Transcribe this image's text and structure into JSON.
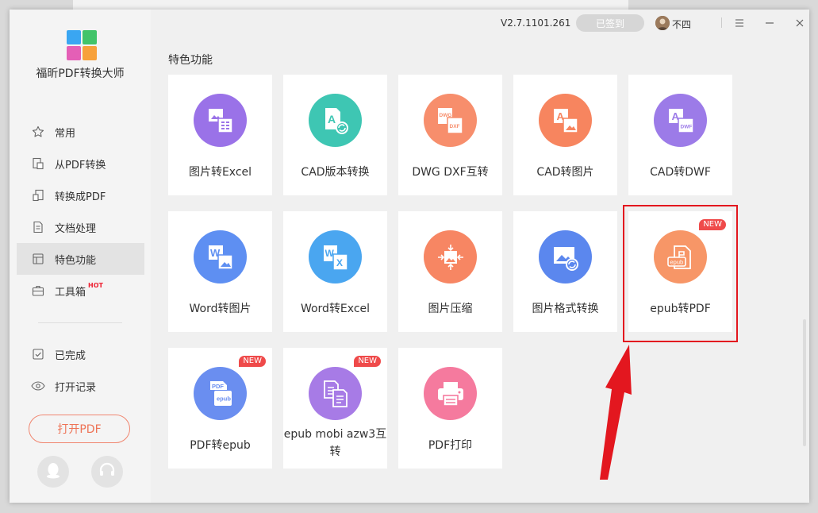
{
  "app": {
    "name": "福昕PDF转换大师",
    "version": "V2.7.1101.261",
    "signed_label": "已签到",
    "username": "不四"
  },
  "sidebar": {
    "items": [
      {
        "label": "常用",
        "icon": "star-icon"
      },
      {
        "label": "从PDF转换",
        "icon": "document-export-icon"
      },
      {
        "label": "转换成PDF",
        "icon": "document-import-icon"
      },
      {
        "label": "文档处理",
        "icon": "document-edit-icon"
      },
      {
        "label": "特色功能",
        "icon": "special-feature-icon",
        "active": true
      },
      {
        "label": "工具箱",
        "icon": "toolbox-icon",
        "badge": "HOT"
      },
      {
        "label": "已完成",
        "icon": "check-box-icon"
      },
      {
        "label": "打开记录",
        "icon": "eye-icon"
      }
    ],
    "open_pdf_label": "打开PDF"
  },
  "main": {
    "section_title": "特色功能",
    "cards": [
      {
        "label": "图片转Excel",
        "color": "#9a72e8",
        "icon": "image-to-excel-icon"
      },
      {
        "label": "CAD版本转换",
        "color": "#3ec6b3",
        "icon": "cad-version-convert-icon"
      },
      {
        "label": "DWG DXF互转",
        "color": "#f78e6c",
        "icon": "dwg-dxf-convert-icon"
      },
      {
        "label": "CAD转图片",
        "color": "#f7855f",
        "icon": "cad-to-image-icon"
      },
      {
        "label": "CAD转DWF",
        "color": "#9c7be8",
        "icon": "cad-to-dwf-icon"
      },
      {
        "label": "Word转图片",
        "color": "#5e8ff2",
        "icon": "word-to-image-icon"
      },
      {
        "label": "Word转Excel",
        "color": "#4aa6f0",
        "icon": "word-to-excel-icon"
      },
      {
        "label": "图片压缩",
        "color": "#f78663",
        "icon": "image-compress-icon"
      },
      {
        "label": "图片格式转换",
        "color": "#5b87ee",
        "icon": "image-format-convert-icon"
      },
      {
        "label": "epub转PDF",
        "color": "#f79667",
        "icon": "epub-to-pdf-icon",
        "badge": "NEW"
      },
      {
        "label": "PDF转epub",
        "color": "#6a8ef0",
        "icon": "pdf-to-epub-icon",
        "badge": "NEW"
      },
      {
        "label": "epub mobi azw3互转",
        "color": "#a77be6",
        "icon": "ebook-format-convert-icon",
        "badge": "NEW"
      },
      {
        "label": "PDF打印",
        "color": "#f57a9e",
        "icon": "printer-icon"
      }
    ]
  },
  "annotation": {
    "highlight_color": "#e3171f",
    "arrow_color": "#e3171f"
  }
}
